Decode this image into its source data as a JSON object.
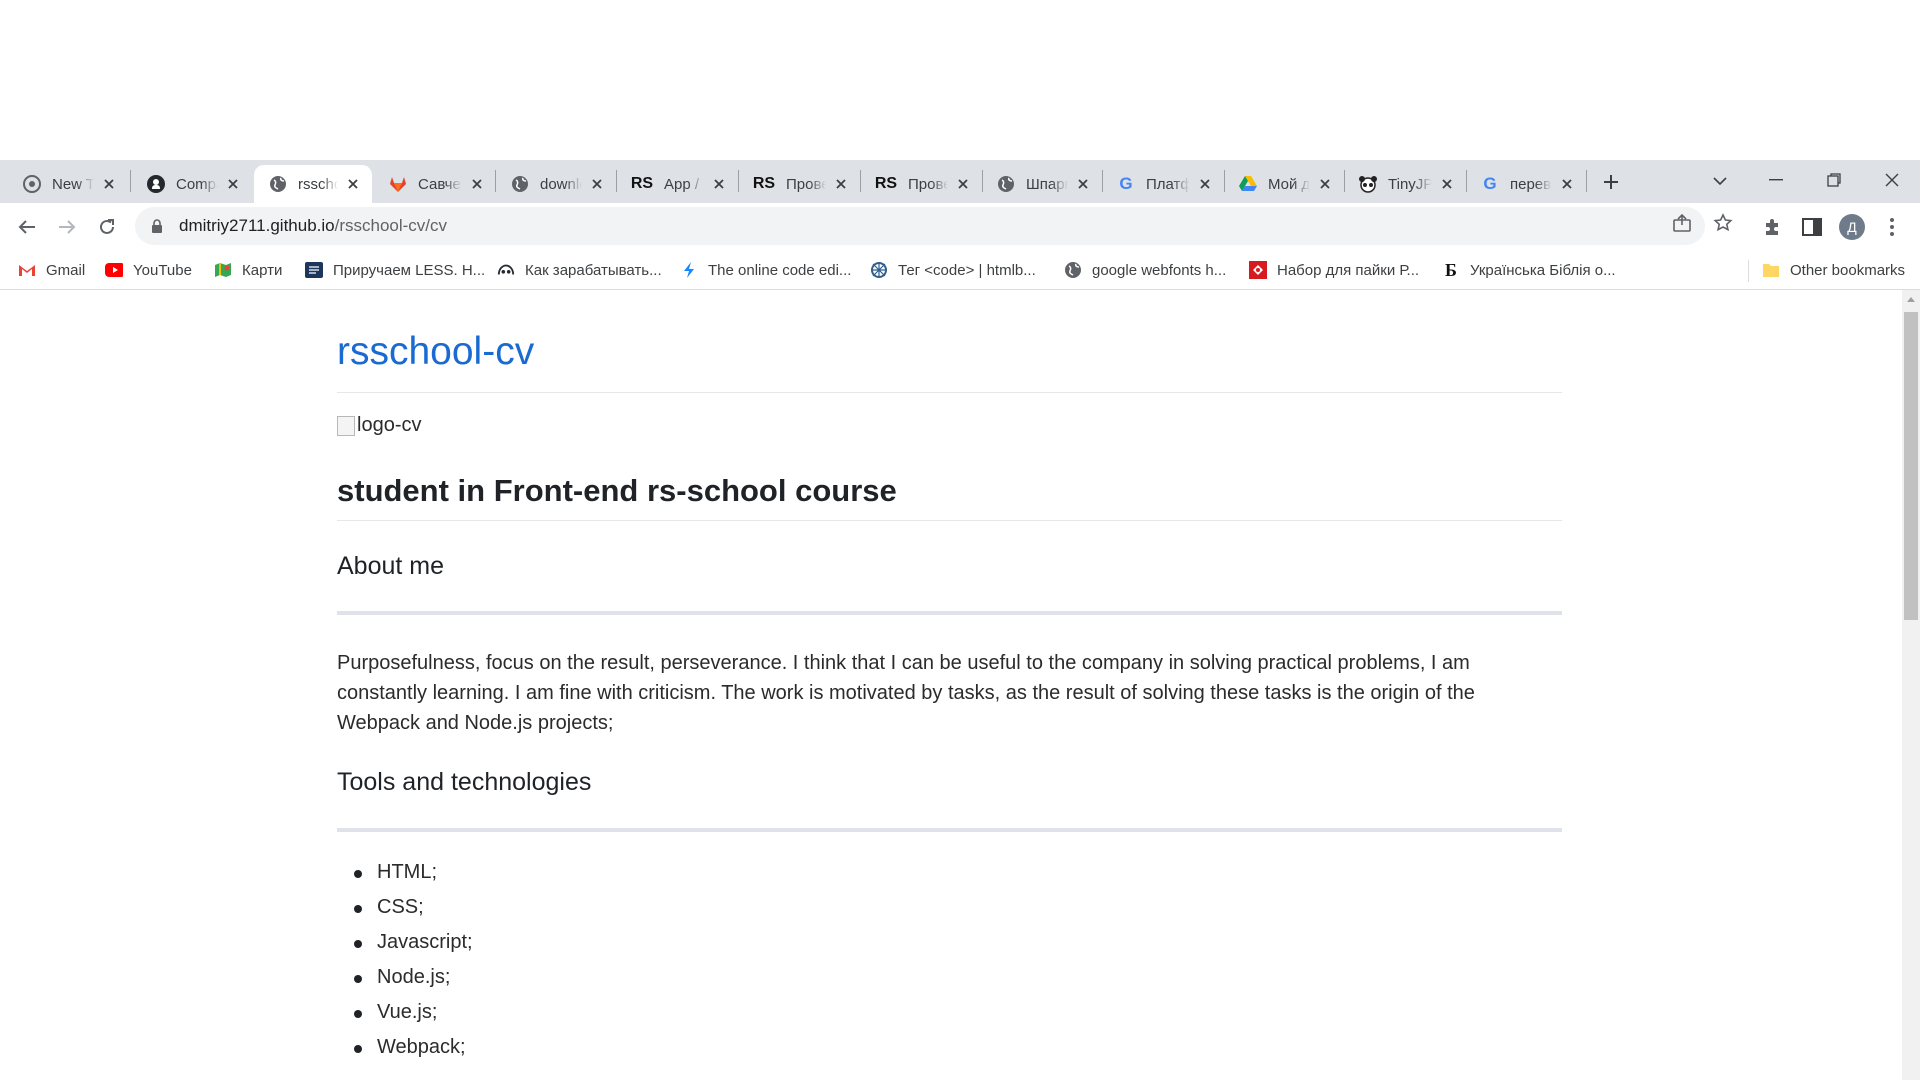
{
  "browser": {
    "tabs": [
      {
        "label": "New Tab",
        "icon": "chrome-icon"
      },
      {
        "label": "Compare",
        "icon": "github-icon"
      },
      {
        "label": "rsschool-cv",
        "icon": "globe-icon",
        "active": true
      },
      {
        "label": "Савченко",
        "icon": "gitlab-icon"
      },
      {
        "label": "download",
        "icon": "globe-icon"
      },
      {
        "label": "App / ",
        "icon": "rs-icon"
      },
      {
        "label": "Проверка",
        "icon": "rs-icon"
      },
      {
        "label": "Проверка",
        "icon": "rs-icon"
      },
      {
        "label": "Шпаргалка",
        "icon": "globe-icon"
      },
      {
        "label": "Платформа",
        "icon": "google-icon"
      },
      {
        "label": "Мой диск",
        "icon": "drive-icon"
      },
      {
        "label": "TinyJPG",
        "icon": "panda-icon"
      },
      {
        "label": "перевод",
        "icon": "google-icon"
      }
    ],
    "url_domain": "dmitriy2711.github.io",
    "url_path": "/rsschool-cv/cv",
    "profile_initial": "Д",
    "bookmarks": [
      {
        "label": "Gmail",
        "icon": "gmail-icon"
      },
      {
        "label": "YouTube",
        "icon": "youtube-icon"
      },
      {
        "label": "Карти",
        "icon": "maps-icon"
      },
      {
        "label": "Приручаем LESS. H...",
        "icon": "less-icon"
      },
      {
        "label": "Как зарабатывать...",
        "icon": "github-icon"
      },
      {
        "label": "The online code edi...",
        "icon": "bolt-icon"
      },
      {
        "label": "Тег <code> | htmlb...",
        "icon": "htmlbook-icon"
      },
      {
        "label": "google webfonts h...",
        "icon": "globe-icon"
      },
      {
        "label": "Набор для пайки Р...",
        "icon": "kit-icon"
      },
      {
        "label": "Українська Біблія о...",
        "icon": "bible-icon"
      }
    ],
    "other_bookmarks": "Other bookmarks"
  },
  "page": {
    "title": "rsschool-cv",
    "logo_alt": "logo-cv",
    "subtitle": "student in Front-end rs-school course",
    "about_heading": "About me",
    "about_text": "Purposefulness, focus on the result, perseverance. I think that I can be useful to the company in solving practical problems, I am constantly learning. I am fine with criticism. The work is motivated by tasks, as the result of solving these tasks is the origin of the Webpack and Node.js projects;",
    "tools_heading": "Tools and technologies",
    "tools": [
      "HTML;",
      "CSS;",
      "Javascript;",
      "Node.js;",
      "Vue.js;",
      "Webpack;"
    ]
  }
}
